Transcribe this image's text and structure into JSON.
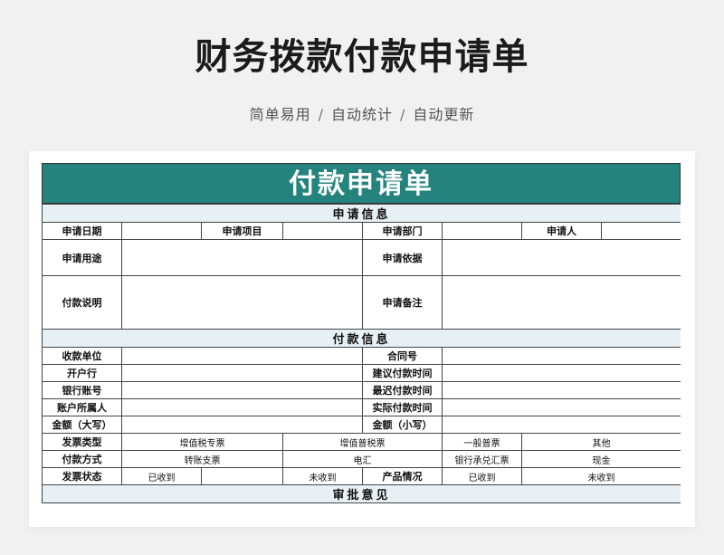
{
  "header": {
    "title": "财务拨款付款申请单",
    "subtitle_parts": [
      "简单易用",
      "自动统计",
      "自动更新"
    ],
    "separator": "/"
  },
  "form": {
    "title": "付款申请单",
    "sections": {
      "apply_info": "申请信息",
      "payment_info": "付款信息",
      "approval": "审批意见"
    },
    "labels": {
      "apply_date": "申请日期",
      "apply_item": "申请项目",
      "apply_dept": "申请部门",
      "applicant": "申请人",
      "apply_purpose": "申请用途",
      "apply_basis": "申请依据",
      "payment_desc": "付款说明",
      "apply_remark": "申请备注",
      "payee": "收款单位",
      "contract_no": "合同号",
      "bank": "开户行",
      "suggest_time": "建议付款时间",
      "bank_account": "银行账号",
      "latest_time": "最迟付款时间",
      "account_owner": "账户所属人",
      "actual_time": "实际付款时间",
      "amount_upper": "金额（大写）",
      "amount_lower": "金额（小写）",
      "invoice_type": "发票类型",
      "pay_method": "付款方式",
      "invoice_status": "发票状态",
      "product_status": "产品情况"
    },
    "options": {
      "invoice_type": [
        "增值税专票",
        "增值普税票",
        "一般普票",
        "其他"
      ],
      "pay_method": [
        "转账支票",
        "电汇",
        "银行承兑汇票",
        "现金"
      ],
      "invoice_status": [
        "已收到",
        "未收到"
      ],
      "product_status": [
        "已收到",
        "未收到"
      ]
    }
  }
}
